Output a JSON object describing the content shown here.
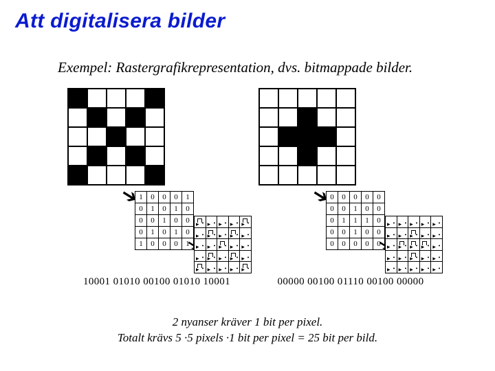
{
  "title": "Att digitalisera bilder",
  "subtitle": "Exempel: Rastergrafikrepresentation, dvs. bitmappade bilder.",
  "chart_data": [
    {
      "type": "table",
      "title": "bitmap-x",
      "columns": 5,
      "rows": 5,
      "cells": [
        1,
        0,
        0,
        0,
        1,
        0,
        1,
        0,
        1,
        0,
        0,
        0,
        1,
        0,
        0,
        0,
        1,
        0,
        1,
        0,
        1,
        0,
        0,
        0,
        1
      ],
      "bitstring": "10001 01010 00100 01010 10001"
    },
    {
      "type": "table",
      "title": "bitmap-plus",
      "columns": 5,
      "rows": 5,
      "cells": [
        0,
        0,
        0,
        0,
        0,
        0,
        0,
        1,
        0,
        0,
        0,
        1,
        1,
        1,
        0,
        0,
        0,
        1,
        0,
        0,
        0,
        0,
        0,
        0,
        0
      ],
      "bitstring": "00000 00100 01110 00100 00000"
    }
  ],
  "caption_line1": "2 nyanser kräver 1 bit per pixel.",
  "caption_line2": "Totalt krävs 5 ·5 pixels ·1 bit per pixel = 25 bit per bild."
}
